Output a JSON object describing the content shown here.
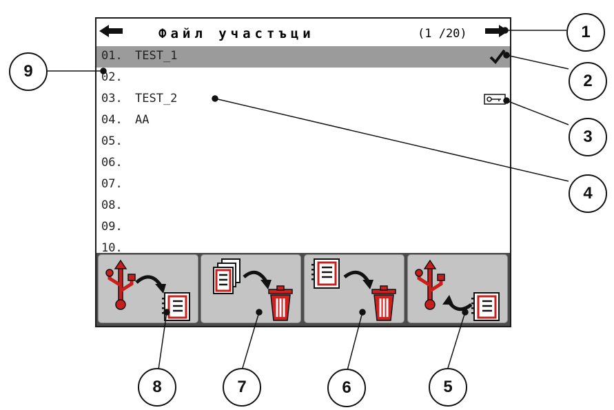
{
  "header": {
    "title": "Файл участъци",
    "page_indicator": "(1 /20)",
    "left_icon": "arrow-left-icon",
    "right_icon": "arrow-right-icon"
  },
  "rows": [
    {
      "num": "01.",
      "name": "TEST_1",
      "selected": true,
      "mark": "check-icon"
    },
    {
      "num": "02.",
      "name": ""
    },
    {
      "num": "03.",
      "name": "TEST_2",
      "mark": "lock-key-icon"
    },
    {
      "num": "04.",
      "name": "AA"
    },
    {
      "num": "05.",
      "name": ""
    },
    {
      "num": "06.",
      "name": ""
    },
    {
      "num": "07.",
      "name": ""
    },
    {
      "num": "08.",
      "name": ""
    },
    {
      "num": "09.",
      "name": ""
    },
    {
      "num": "10.",
      "name": ""
    }
  ],
  "softkeys": [
    {
      "icon": "usb-import-file-icon"
    },
    {
      "icon": "delete-all-files-icon"
    },
    {
      "icon": "delete-file-icon"
    },
    {
      "icon": "usb-export-file-icon"
    }
  ],
  "callouts": [
    "1",
    "2",
    "3",
    "4",
    "5",
    "6",
    "7",
    "8",
    "9"
  ],
  "colors": {
    "selected_row": "#9b9b9b",
    "softkey_bar": "#4b4b4b",
    "softkey": "#c4c4c4",
    "trash_red": "#d1211f",
    "usb_red": "#c81f1d"
  }
}
